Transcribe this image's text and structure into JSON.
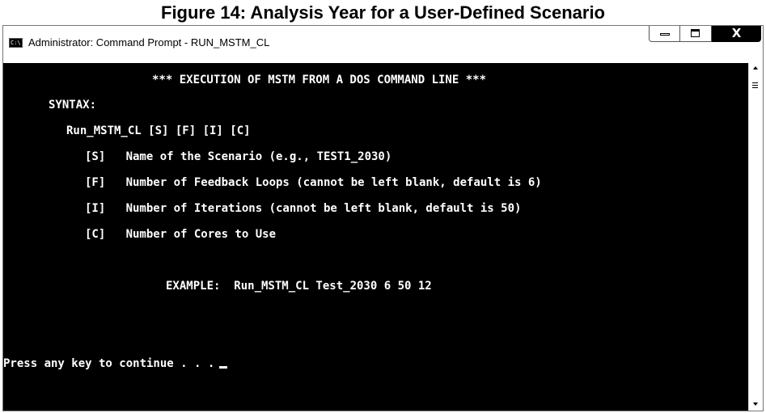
{
  "figure": {
    "caption": "Figure 14:  Analysis Year for a User-Defined Scenario"
  },
  "window": {
    "title": "Administrator: Command Prompt - RUN_MSTM_CL",
    "app_icon": "cmd-icon",
    "app_icon_text": "C:\\",
    "controls": {
      "minimize": "minimize-icon",
      "maximize": "maximize-icon",
      "close_label": "X"
    }
  },
  "console": {
    "background": "#000000",
    "foreground": "#ffffff",
    "lines": {
      "header": "*** EXECUTION OF MSTM FROM A DOS COMMAND LINE ***",
      "syntax_label": "SYNTAX:",
      "syntax_command": "Run_MSTM_CL [S] [F] [I] [C]",
      "param_s": "[S]   Name of the Scenario (e.g., TEST1_2030)",
      "param_f": "[F]   Number of Feedback Loops (cannot be left blank, default is 6)",
      "param_i": "[I]   Number of Iterations (cannot be left blank, default is 50)",
      "param_c": "[C]   Number of Cores to Use",
      "example": "EXAMPLE:  Run_MSTM_CL Test_2030 6 50 12",
      "prompt": "Press any key to continue . . ."
    }
  },
  "scrollbar": {
    "up": "arrow-up-icon",
    "down": "arrow-down-icon"
  }
}
